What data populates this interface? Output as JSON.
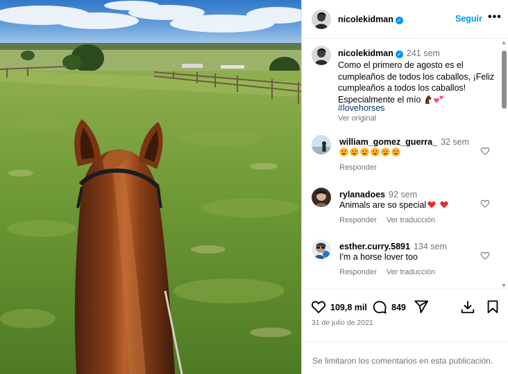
{
  "post": {
    "username": "nicolekidman",
    "follow_label": "Seguir",
    "more_label": "•••",
    "verified_mark": "✓"
  },
  "caption": {
    "username": "nicolekidman",
    "time": "241 sem",
    "text": "Como el primero de agosto es el cumpleaños de todos los caballos, ¡Feliz cumpleaños a todos los caballos! Especialmente el mío",
    "hashtag": "#lovehorses",
    "see_original": "Ver original"
  },
  "comments": [
    {
      "username": "william_gomez_guerra_",
      "time": "32 sem",
      "text": "",
      "reply": "Responder",
      "translate": ""
    },
    {
      "username": "rylanadoes",
      "time": "92 sem",
      "text": "Animals are so special",
      "reply": "Responder",
      "translate": "Ver traducción"
    },
    {
      "username": "esther.curry.5891",
      "time": "134 sem",
      "text": "I'm a horse lover too",
      "reply": "Responder",
      "translate": "Ver traducción"
    }
  ],
  "actions": {
    "likes": "109,8 mil",
    "comments_count": "849",
    "date": "31 de julio de 2021"
  },
  "footer": {
    "limited_text": "Se limitaron los comentarios en esta publicación."
  },
  "colors": {
    "accent": "#0095f6",
    "muted": "#737373",
    "hashtag": "#00376b",
    "emoji_heart": "#e8262e"
  },
  "icons": {
    "like": "heart-outline-icon",
    "comment": "speech-bubble-icon",
    "share": "paper-plane-icon",
    "save": "bookmark-icon",
    "download": "download-icon"
  }
}
